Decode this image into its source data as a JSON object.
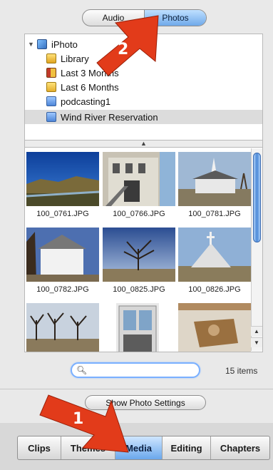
{
  "top_segments": [
    {
      "label": "Audio",
      "active": false
    },
    {
      "label": "Photos",
      "active": true
    }
  ],
  "source_tree": [
    {
      "label": "iPhoto",
      "icon": "iphoto-icon",
      "expanded": true
    },
    {
      "label": "Library",
      "icon": "library-icon"
    },
    {
      "label": "Last 3 Months",
      "icon": "calendar-icon"
    },
    {
      "label": "Last 6 Months",
      "icon": "calendar-icon"
    },
    {
      "label": "podcasting1",
      "icon": "album-icon"
    },
    {
      "label": "Wind River Reservation",
      "icon": "album-icon",
      "selected": true
    }
  ],
  "photos": [
    {
      "name": "100_0761.JPG"
    },
    {
      "name": "100_0766.JPG"
    },
    {
      "name": "100_0781.JPG"
    },
    {
      "name": "100_0782.JPG"
    },
    {
      "name": "100_0825.JPG"
    },
    {
      "name": "100_0826.JPG"
    },
    {
      "name": ""
    },
    {
      "name": ""
    },
    {
      "name": ""
    }
  ],
  "search": {
    "value": "",
    "placeholder": ""
  },
  "item_count": "15 items",
  "photo_settings_label": "Show Photo Settings",
  "bottom_tabs": [
    {
      "label": "Clips",
      "active": false
    },
    {
      "label": "Themes",
      "active": false
    },
    {
      "label": "Media",
      "active": true
    },
    {
      "label": "Editing",
      "active": false
    },
    {
      "label": "Chapters",
      "active": false
    }
  ],
  "callouts": [
    {
      "number": "1",
      "color": "#e23b1a"
    },
    {
      "number": "2",
      "color": "#e23b1a"
    }
  ],
  "colors": {
    "active_segment": "#6fa9ea",
    "selected_row": "#dcdcdc",
    "callout": "#e23b1a"
  }
}
